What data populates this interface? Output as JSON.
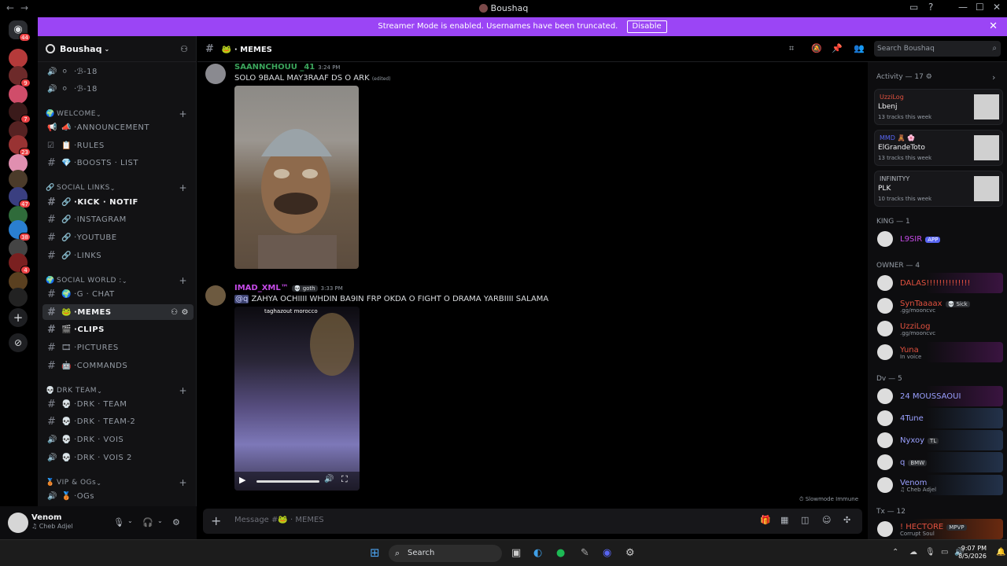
{
  "window": {
    "title": "Boushaq"
  },
  "banner": {
    "text": "Streamer Mode is enabled. Usernames have been truncated.",
    "button": "Disable"
  },
  "guild_badges": [
    "44",
    "9",
    "7",
    "23",
    "47",
    "38",
    "4"
  ],
  "server": {
    "name": "Boushaq"
  },
  "channels": [
    {
      "type": "voice",
      "emoji": "⚪",
      "name": "ℬ-18"
    },
    {
      "type": "voice",
      "emoji": "⚪",
      "name": "ℬ-18"
    },
    {
      "type": "category",
      "emoji": "🌍",
      "name": "WELCOME"
    },
    {
      "type": "announce",
      "emoji": "📣",
      "name": "ANNOUNCEMENT"
    },
    {
      "type": "rules",
      "emoji": "📋",
      "name": "RULES"
    },
    {
      "type": "text",
      "emoji": "💎",
      "name": "BOOSTS · LIST"
    },
    {
      "type": "category",
      "emoji": "🔗",
      "name": "SOCIAL LINKS"
    },
    {
      "type": "text",
      "emoji": "🔗",
      "name": "KICK · NOTIF",
      "bold": true
    },
    {
      "type": "text",
      "emoji": "🔗",
      "name": "INSTAGRAM"
    },
    {
      "type": "text",
      "emoji": "🔗",
      "name": "YOUTUBE"
    },
    {
      "type": "text",
      "emoji": "🔗",
      "name": "LINKS"
    },
    {
      "type": "category",
      "emoji": "🌍",
      "name": "SOCIAL WORLD :"
    },
    {
      "type": "text",
      "emoji": "🌍",
      "name": "G · CHAT"
    },
    {
      "type": "text",
      "emoji": "🐸",
      "name": "MEMES",
      "active": true
    },
    {
      "type": "text",
      "emoji": "🎬",
      "name": "CLIPS",
      "bold": true
    },
    {
      "type": "text",
      "emoji": "🎞",
      "name": "PICTURES"
    },
    {
      "type": "text",
      "emoji": "🤖",
      "name": "COMMANDS"
    },
    {
      "type": "category",
      "emoji": "💀",
      "name": "DRK TEAM"
    },
    {
      "type": "text",
      "emoji": "💀",
      "name": "DRK · TEAM"
    },
    {
      "type": "text",
      "emoji": "💀",
      "name": "DRK · TEAM-2"
    },
    {
      "type": "voice",
      "emoji": "💀",
      "name": "DRK · VOIS"
    },
    {
      "type": "voice",
      "emoji": "💀",
      "name": "DRK · VOIS 2"
    },
    {
      "type": "category",
      "emoji": "🥉",
      "name": "VIP & OGs"
    },
    {
      "type": "voice",
      "emoji": "🥉",
      "name": "OGs"
    }
  ],
  "user": {
    "name": "Venom",
    "status": "♫ Cheb Adjel"
  },
  "topbar": {
    "channel": "🐸 · MEMES",
    "search_placeholder": "Search Boushaq"
  },
  "messages": [
    {
      "author": "SAANNCHOUU _41",
      "time": "3:24 PM",
      "text": "SOLO 9BAAL MAY3RAAF DS O ARK",
      "edited": "(edited)"
    },
    {
      "author": "IMAD_XML™",
      "tag": "💀 goth",
      "time": "3:33 PM",
      "mention": "@q",
      "text": "ZAHYA OCHIIII WHDIN BA9IN FRP OKDA O FIGHT O DRAMA YARBIIII SALAMA",
      "video_overlay": "taghazout morocco"
    }
  ],
  "slowmode": "Slowmode Immune",
  "composer": {
    "placeholder": "Message #🐸 · MEMES"
  },
  "members": {
    "activity_header": "Activity — 17 ⚙",
    "activity": [
      {
        "name": "UzziLog",
        "track": "Lbenj",
        "count": "13 tracks this week",
        "color": "#e2513f"
      },
      {
        "name": "MMD 🧸 🌸",
        "track": "ElGrandeToto",
        "count": "13 tracks this week",
        "color": "#5865f2"
      },
      {
        "name": "INFINITYY",
        "track": "PLK",
        "count": "10 tracks this week",
        "color": "#b5bac1"
      }
    ],
    "groups": [
      {
        "title": "KING — 1",
        "members": [
          {
            "name": "L9SIR",
            "badge": "APP",
            "color": "#c64be8"
          }
        ]
      },
      {
        "title": "OWNER — 4",
        "members": [
          {
            "name": "DALAS!!!!!!!!!!!!!!",
            "color": "#e2513f",
            "status": ""
          },
          {
            "name": "SynTaaaax",
            "tag": "💀 Sick",
            "color": "#e2513f",
            "status": ".gg/mooncvc"
          },
          {
            "name": "UzziLog",
            "color": "#e2513f",
            "status": ".gg/mooncvc"
          },
          {
            "name": "Yuna",
            "color": "#e2513f",
            "status": "In voice"
          }
        ]
      },
      {
        "title": "Dv — 5",
        "members": [
          {
            "name": "24 MOUSSAOUI",
            "color": "#9aa0ff",
            "status": ""
          },
          {
            "name": "4Tune",
            "color": "#9aa0ff",
            "status": ""
          },
          {
            "name": "Nyxoy",
            "tag": "TL",
            "color": "#9aa0ff",
            "status": ""
          },
          {
            "name": "q",
            "tag": "BMW",
            "color": "#9aa0ff",
            "status": ""
          },
          {
            "name": "Venom",
            "color": "#9aa0ff",
            "status": "♫ Cheb Adjel"
          }
        ]
      },
      {
        "title": "Tx — 12",
        "members": [
          {
            "name": "! HECTORE",
            "tag": "MPVP",
            "color": "#e2513f",
            "status": "Corrupt Soul"
          }
        ]
      }
    ]
  },
  "taskbar": {
    "search": "Search",
    "time": "9:07 PM",
    "date": "8/5/2026"
  }
}
